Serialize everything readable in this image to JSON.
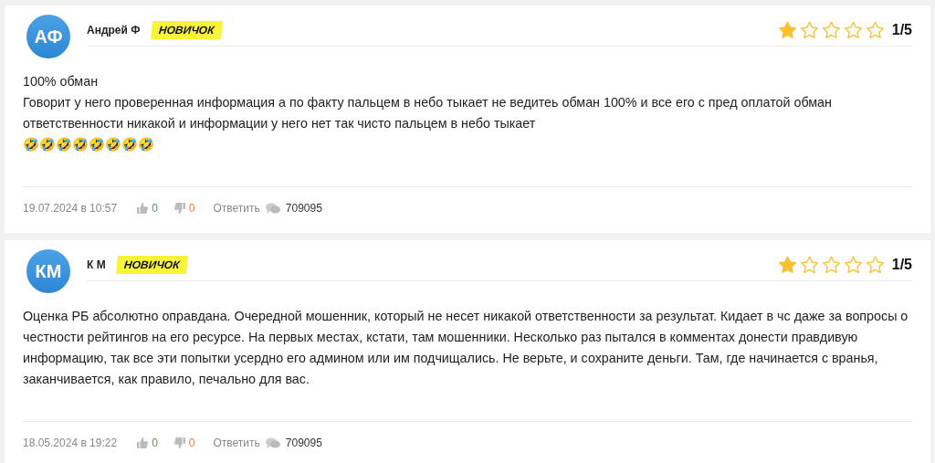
{
  "reviews": [
    {
      "avatar": "АФ",
      "author": "Андрей Ф",
      "badge": "НОВИЧОК",
      "stars": 1,
      "score": "1/5",
      "paragraphs": [
        "100% обман",
        "Говорит у него проверенная информация а по факту пальцем в небо тыкает не ведитеь обман 100% и все его с пред оплатой обман ответственности никакой и информации у него нет так чисто пальцем в небо тыкает",
        "🤣🤣🤣🤣🤣🤣🤣🤣"
      ],
      "date": "19.07.2024 в 10:57",
      "likes": "0",
      "dislikes": "0",
      "reply": "Ответить",
      "comment_id": "709095"
    },
    {
      "avatar": "КМ",
      "author": "К М",
      "badge": "НОВИЧОК",
      "stars": 1,
      "score": "1/5",
      "paragraphs": [
        "Оценка РБ абсолютно оправдана. Очередной мошенник, который не несет никакой ответственности за результат. Кидает в чс даже за вопросы о честности рейтингов на его ресурсе. На первых местах, кстати, там мошенники. Несколько раз пытался в комментах донести правдивую информацию, так все эти попытки усердно его админом или им подчищались. Не верьте, и сохраните деньги. Там, где начинается с вранья, заканчивается, как правило, печально для вас."
      ],
      "date": "18.05.2024 в 19:22",
      "likes": "0",
      "dislikes": "0",
      "reply": "Ответить",
      "comment_id": "709095"
    }
  ]
}
